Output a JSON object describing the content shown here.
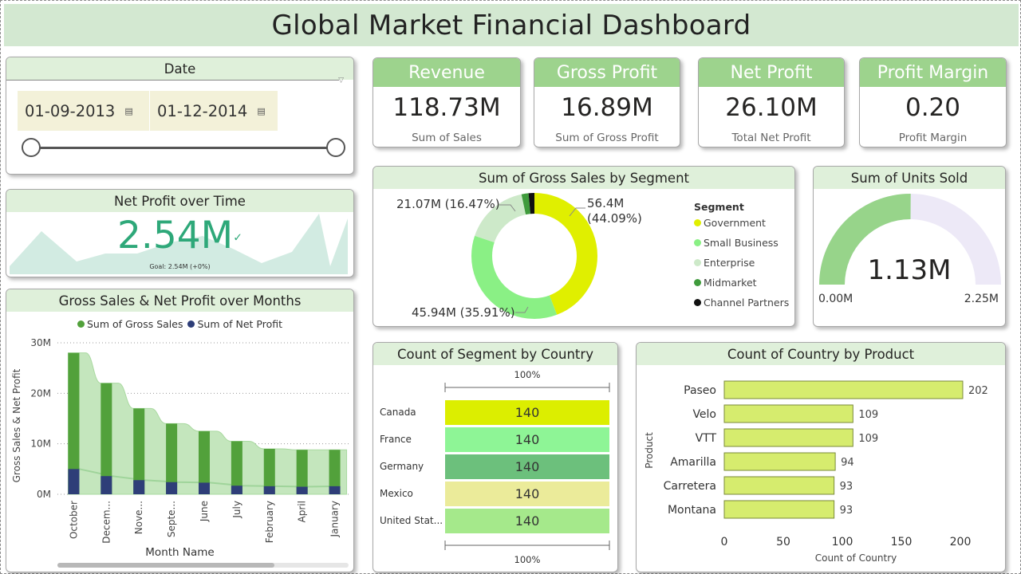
{
  "header": {
    "title": "Global Market Financial Dashboard"
  },
  "date_slicer": {
    "title": "Date",
    "start": "01-09-2013",
    "end": "01-12-2014"
  },
  "kpis": [
    {
      "title": "Revenue",
      "value": "118.73M",
      "sub": "Sum of  Sales"
    },
    {
      "title": "Gross Profit",
      "value": "16.89M",
      "sub": "Sum of Gross Profit"
    },
    {
      "title": "Net Profit",
      "value": "26.10M",
      "sub": "Total Net Profit"
    },
    {
      "title": "Profit Margin",
      "value": "0.20",
      "sub": "Profit Margin"
    }
  ],
  "net_profit_time": {
    "title": "Net Profit over Time",
    "value": "2.54M",
    "goal": "Goal: 2.54M (+0%)",
    "check": "✓"
  },
  "segment_donut": {
    "title": "Sum of Gross Sales by Segment",
    "legend_title": "Segment",
    "labels": {
      "government": "56.4M\n(44.09%)",
      "small_business": "45.94M (35.91%)",
      "enterprise": "21.07M (16.47%)"
    },
    "label_lines": [
      "56.4M",
      "(44.09%)"
    ]
  },
  "units_gauge": {
    "title": "Sum of Units Sold",
    "value": "1.13M",
    "min": "0.00M",
    "max": "2.25M",
    "fraction": 0.502,
    "color": "#97d48a",
    "bg_color": "#ede9f7"
  },
  "country_table": {
    "title": "Count of Segment by Country",
    "top_label": "100%",
    "bottom_label": "100%",
    "rows": [
      {
        "country": "Canada",
        "value": "140",
        "color": "#dcee00"
      },
      {
        "country": "France",
        "value": "140",
        "color": "#8ef596"
      },
      {
        "country": "Germany",
        "value": "140",
        "color": "#6cc07c"
      },
      {
        "country": "Mexico",
        "value": "140",
        "color": "#ebeb9a"
      },
      {
        "country": "United Stat...",
        "value": "140",
        "color": "#a5e98b"
      }
    ]
  },
  "chart_data": [
    {
      "type": "bar",
      "title": "Gross Sales & Net Profit over Months",
      "xlabel": "Month Name",
      "ylabel": "Gross Sales & Net Profit",
      "legend_position": "top",
      "categories": [
        "October",
        "Decem...",
        "Nove...",
        "Septe...",
        "June",
        "July",
        "February",
        "April",
        "January"
      ],
      "ylim": [
        0,
        30
      ],
      "yticks": [
        "0M",
        "10M",
        "20M",
        "30M"
      ],
      "series": [
        {
          "name": "Sum of Gross Sales",
          "color": "#52a13b",
          "values": [
            28.0,
            22.0,
            17.0,
            14.0,
            12.5,
            10.5,
            9.0,
            8.8,
            8.8
          ]
        },
        {
          "name": "Sum of Net Profit",
          "color": "#2e3e78",
          "values": [
            5.0,
            3.6,
            2.8,
            2.4,
            2.3,
            1.7,
            1.6,
            1.5,
            1.6
          ]
        }
      ]
    },
    {
      "type": "donut",
      "title": "Sum of Gross Sales by Segment",
      "categories": [
        "Government",
        "Small Business",
        "Enterprise",
        "Midmarket",
        "Channel Partners"
      ],
      "values": [
        56.4,
        45.94,
        21.07,
        2.3,
        1.97
      ],
      "colors": [
        "#e0ef00",
        "#8af085",
        "#cde9c9",
        "#3f9b3c",
        "#111111"
      ]
    },
    {
      "type": "bar",
      "orientation": "horizontal",
      "title": "Count of Country by Product",
      "xlabel": "Count of Country",
      "ylabel": "Product",
      "categories": [
        "Paseo",
        "Velo",
        "VTT",
        "Amarilla",
        "Carretera",
        "Montana"
      ],
      "values": [
        202,
        109,
        109,
        94,
        93,
        93
      ],
      "xticks": [
        0,
        50,
        100,
        150,
        200
      ],
      "xlim": [
        0,
        200
      ],
      "color": "#d6ec6e"
    }
  ]
}
